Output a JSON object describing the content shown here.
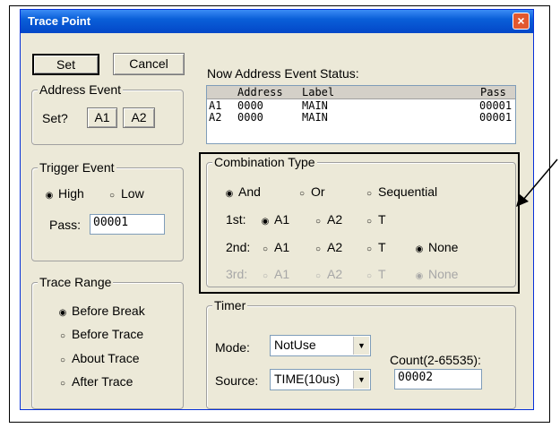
{
  "window": {
    "title": "Trace Point",
    "close_glyph": "×"
  },
  "buttons": {
    "set": "Set",
    "cancel": "Cancel"
  },
  "address_event": {
    "title": "Address Event",
    "prompt": "Set?",
    "a1": "A1",
    "a2": "A2"
  },
  "status": {
    "title": "Now Address Event Status:",
    "columns": [
      "Address",
      "Label",
      "Pass"
    ],
    "rows": [
      {
        "name": "A1",
        "address": "0000",
        "label": "MAIN",
        "pass": "00001"
      },
      {
        "name": "A2",
        "address": "0000",
        "label": "MAIN",
        "pass": "00001"
      }
    ]
  },
  "trigger_event": {
    "title": "Trigger Event",
    "high": "High",
    "low": "Low",
    "selected": "High",
    "pass_label": "Pass:",
    "pass_value": "00001"
  },
  "combination": {
    "title": "Combination Type",
    "types": [
      "And",
      "Or",
      "Sequential"
    ],
    "selected_type": "And",
    "rows": [
      {
        "label": "1st:",
        "options": [
          "A1",
          "A2",
          "T"
        ],
        "selected": "A1",
        "enabled": true
      },
      {
        "label": "2nd:",
        "options": [
          "A1",
          "A2",
          "T",
          "None"
        ],
        "selected": "None",
        "enabled": true
      },
      {
        "label": "3rd:",
        "options": [
          "A1",
          "A2",
          "T",
          "None"
        ],
        "selected": "None",
        "enabled": false
      }
    ]
  },
  "trace_range": {
    "title": "Trace Range",
    "options": [
      "Before Break",
      "Before Trace",
      "About Trace",
      "After Trace"
    ],
    "selected": "Before Break"
  },
  "timer": {
    "title": "Timer",
    "mode_label": "Mode:",
    "mode_value": "NotUse",
    "source_label": "Source:",
    "source_value": "TIME(10us)",
    "count_label": "Count(2-65535):",
    "count_value": "00002"
  },
  "glyphs": {
    "radio_on": "◉",
    "radio_off": "○",
    "dropdown": "▼"
  }
}
